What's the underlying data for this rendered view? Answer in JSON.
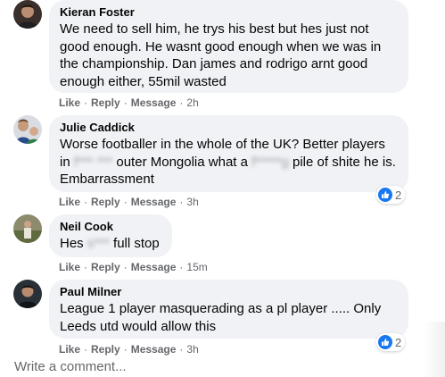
{
  "comments": [
    {
      "author": "Kieran Foster",
      "text": "We need to sell him, he trys his best but hes just not good enough. He wasnt good enough when we was in the championship. Dan james and rodrigo arnt good enough either, 55mil wasted",
      "actions": {
        "like": "Like",
        "reply": "Reply",
        "message": "Message",
        "time": "2h"
      }
    },
    {
      "author": "Julie Caddick",
      "text_parts": [
        "Worse footballer in the whole of the UK? Better players in ",
        "f*** ***",
        " outer Mongolia what a ",
        "f*****g",
        " pile of shite he is. Embarrassment"
      ],
      "actions": {
        "like": "Like",
        "reply": "Reply",
        "message": "Message",
        "time": "3h"
      },
      "reactions": {
        "type": "like-icon",
        "count": "2"
      }
    },
    {
      "author": "Neil Cook",
      "text_parts": [
        "Hes ",
        "s***",
        " full stop"
      ],
      "actions": {
        "like": "Like",
        "reply": "Reply",
        "message": "Message",
        "time": "15m"
      }
    },
    {
      "author": "Paul Milner",
      "text": "League 1 player masquerading as a pl player ..... Only Leeds utd would allow this",
      "actions": {
        "like": "Like",
        "reply": "Reply",
        "message": "Message",
        "time": "3h"
      },
      "reactions": {
        "type": "like-icon",
        "count": "2"
      }
    }
  ],
  "composer": {
    "placeholder": "Write a comment..."
  },
  "colors": {
    "bubble": "#f0f2f5",
    "meta": "#65676b",
    "like_blue": "#1877f2"
  }
}
